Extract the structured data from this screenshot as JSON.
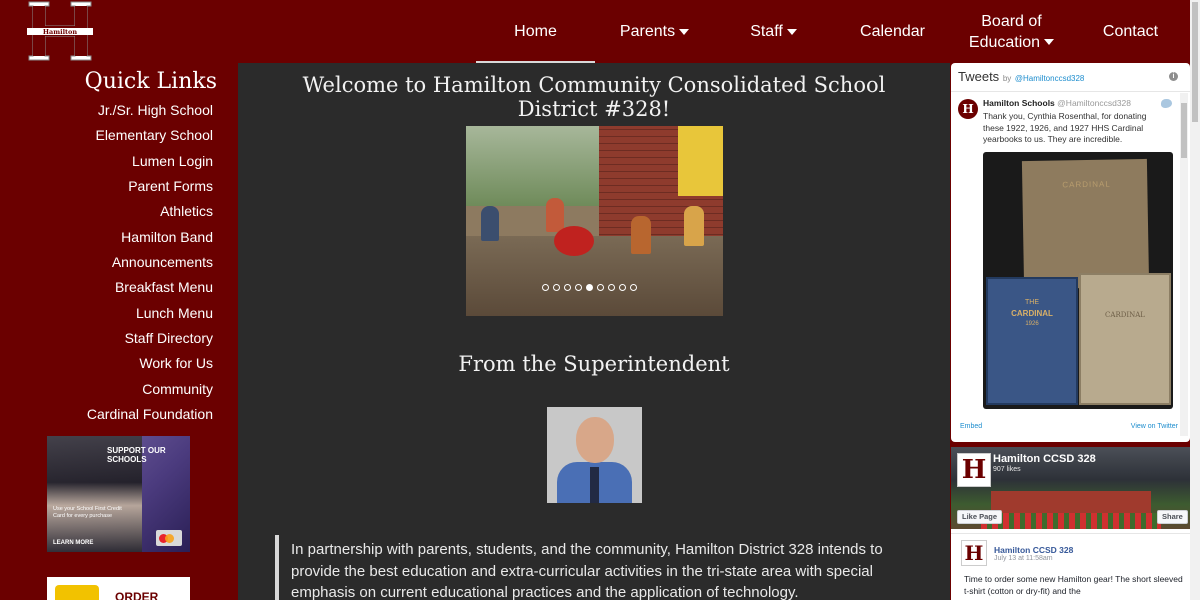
{
  "header": {
    "logo_alt": "Hamilton",
    "nav": [
      {
        "label": "Home",
        "caret": false
      },
      {
        "label": "Parents",
        "caret": true
      },
      {
        "label": "Staff",
        "caret": true
      },
      {
        "label": "Calendar",
        "caret": false
      },
      {
        "label": "Board of Education",
        "line1": "Board of",
        "line2": "Education",
        "caret": true
      },
      {
        "label": "Contact",
        "caret": false
      }
    ]
  },
  "sidebar": {
    "title": "Quick Links",
    "links": [
      "Jr./Sr. High School",
      "Elementary School",
      "Lumen Login",
      "Parent Forms",
      "Athletics",
      "Hamilton Band",
      "Announcements",
      "Breakfast Menu",
      "Lunch Menu",
      "Staff Directory",
      "Work for Us",
      "Community",
      "Cardinal Foundation"
    ],
    "ad1": {
      "headline": "SUPPORT OUR SCHOOLS",
      "sub": "Use your School First Credit Card for every purchase",
      "cta": "LEARN MORE"
    },
    "ad2": {
      "label": "ORDER"
    }
  },
  "main": {
    "welcome_title": "Welcome to Hamilton Community Consolidated School District #328!",
    "slideshow": {
      "slide_count": 9,
      "active_index": 4
    },
    "superintendent_title": "From the Superintendent",
    "quote": "In partnership with parents, students, and the community, Hamilton District 328 intends to provide the best education and extra-curricular activities in the tri-state area with special emphasis on current educational practices and the application of technology."
  },
  "twitter": {
    "title": "Tweets",
    "by": "by",
    "handle": "@Hamiltonccsd328",
    "tweet": {
      "name": "Hamilton Schools",
      "handle": "@Hamiltonccsd328",
      "text": "Thank you, Cynthia Rosenthal, for donating these 1922, 1926, and 1927 HHS Cardinal yearbooks to us. They are incredible.",
      "book1": "CARDINAL",
      "book2_the": "THE",
      "book2_title": "CARDINAL",
      "book2_year": "1926",
      "book3": "CARDINAL"
    },
    "embed": "Embed",
    "view": "View on Twitter"
  },
  "facebook": {
    "page_name": "Hamilton CCSD 328",
    "likes": "907 likes",
    "like_btn": "Like Page",
    "share_btn": "Share",
    "post": {
      "name": "Hamilton CCSD 328",
      "date": "July 13 at 11:58am",
      "text": "Time to order some new Hamilton gear! The short sleeved t-shirt (cotton or dry-fit) and the"
    }
  },
  "colors": {
    "brand": "#6b0000",
    "main_bg": "#2b2b2b",
    "link": "#1d8dce"
  }
}
